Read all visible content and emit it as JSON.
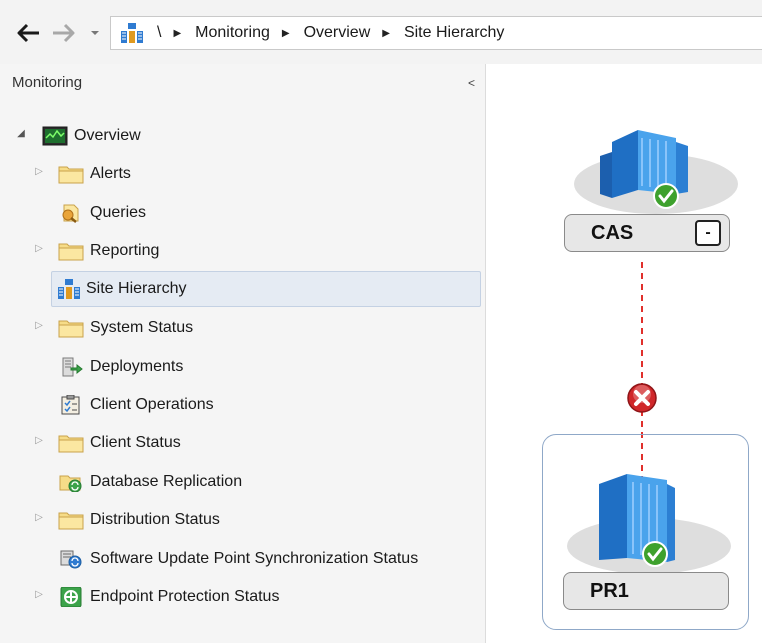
{
  "address_bar": {
    "path": [
      "\\",
      "Monitoring",
      "Overview",
      "Site Hierarchy"
    ]
  },
  "nav_pane": {
    "title": "Monitoring",
    "collapse_glyph": "<",
    "root": {
      "label": "Overview",
      "icon": "monitor-icon"
    },
    "items": [
      {
        "label": "Alerts",
        "icon": "folder-icon",
        "expandable": true
      },
      {
        "label": "Queries",
        "icon": "query-icon",
        "expandable": false
      },
      {
        "label": "Reporting",
        "icon": "folder-icon",
        "expandable": true
      },
      {
        "label": "Site Hierarchy",
        "icon": "site-hierarchy-icon",
        "expandable": false,
        "selected": true
      },
      {
        "label": "System Status",
        "icon": "folder-icon",
        "expandable": true
      },
      {
        "label": "Deployments",
        "icon": "deployment-icon",
        "expandable": false
      },
      {
        "label": "Client Operations",
        "icon": "clipboard-icon",
        "expandable": false
      },
      {
        "label": "Client Status",
        "icon": "folder-icon",
        "expandable": true
      },
      {
        "label": "Database Replication",
        "icon": "database-replication-icon",
        "expandable": false
      },
      {
        "label": "Distribution Status",
        "icon": "folder-icon",
        "expandable": true
      },
      {
        "label": "Software Update Point Synchronization Status",
        "icon": "sync-status-icon",
        "expandable": false
      },
      {
        "label": "Endpoint Protection Status",
        "icon": "shield-icon",
        "expandable": true
      }
    ]
  },
  "diagram": {
    "cas": {
      "label": "CAS",
      "collapse_glyph": "-",
      "status": "ok"
    },
    "link": {
      "status": "error"
    },
    "pr1": {
      "label": "PR1",
      "status": "ok"
    }
  },
  "colors": {
    "ok_green": "#3ea12d",
    "error_red": "#d0272a",
    "link_red": "#e0302c",
    "server_blue": "#2a7fd0",
    "selected_bg": "#e5ebf3"
  }
}
